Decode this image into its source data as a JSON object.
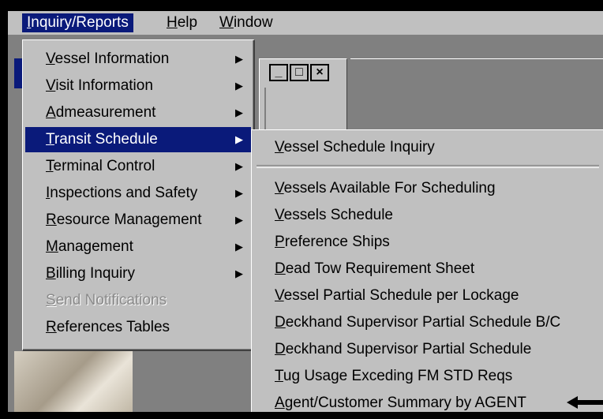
{
  "menubar": {
    "items": [
      {
        "label": "Inquiry/Reports",
        "access": "I"
      },
      {
        "label": "Help",
        "access": "H"
      },
      {
        "label": "Window",
        "access": "W"
      }
    ]
  },
  "inquiry_menu": {
    "items": [
      {
        "label": "Vessel Information",
        "submenu": true
      },
      {
        "label": "Visit Information",
        "submenu": true
      },
      {
        "label": "Admeasurement",
        "submenu": true
      },
      {
        "label": "Transit Schedule",
        "submenu": true,
        "highlighted": true
      },
      {
        "label": "Terminal Control",
        "submenu": true
      },
      {
        "label": "Inspections and Safety",
        "submenu": true
      },
      {
        "label": "Resource Management",
        "submenu": true
      },
      {
        "label": "Management",
        "submenu": true
      },
      {
        "label": "Billing Inquiry",
        "submenu": true
      },
      {
        "label": "Send Notifications",
        "disabled": true
      },
      {
        "label": "References Tables"
      }
    ]
  },
  "transit_submenu": {
    "items": [
      {
        "label": "Vessel Schedule Inquiry"
      },
      {
        "label": "Vessels Available For Scheduling"
      },
      {
        "label": "Vessels Schedule"
      },
      {
        "label": "Preference Ships"
      },
      {
        "label": "Dead Tow Requirement Sheet"
      },
      {
        "label": "Vessel Partial Schedule per Lockage"
      },
      {
        "label": "Deckhand Supervisor Partial Schedule B/C"
      },
      {
        "label": "Deckhand Supervisor Partial Schedule"
      },
      {
        "label": "Tug Usage Exceding FM STD Reqs"
      },
      {
        "label": "Agent/Customer Summary by AGENT"
      }
    ]
  },
  "child_window": {
    "buttons": [
      "_",
      "□",
      "×"
    ]
  },
  "icons": {
    "submenu_arrow": "▶",
    "pointer": "black-left-arrow"
  },
  "colors": {
    "highlight": "#0a1a7a",
    "face": "#c0c0c0"
  }
}
